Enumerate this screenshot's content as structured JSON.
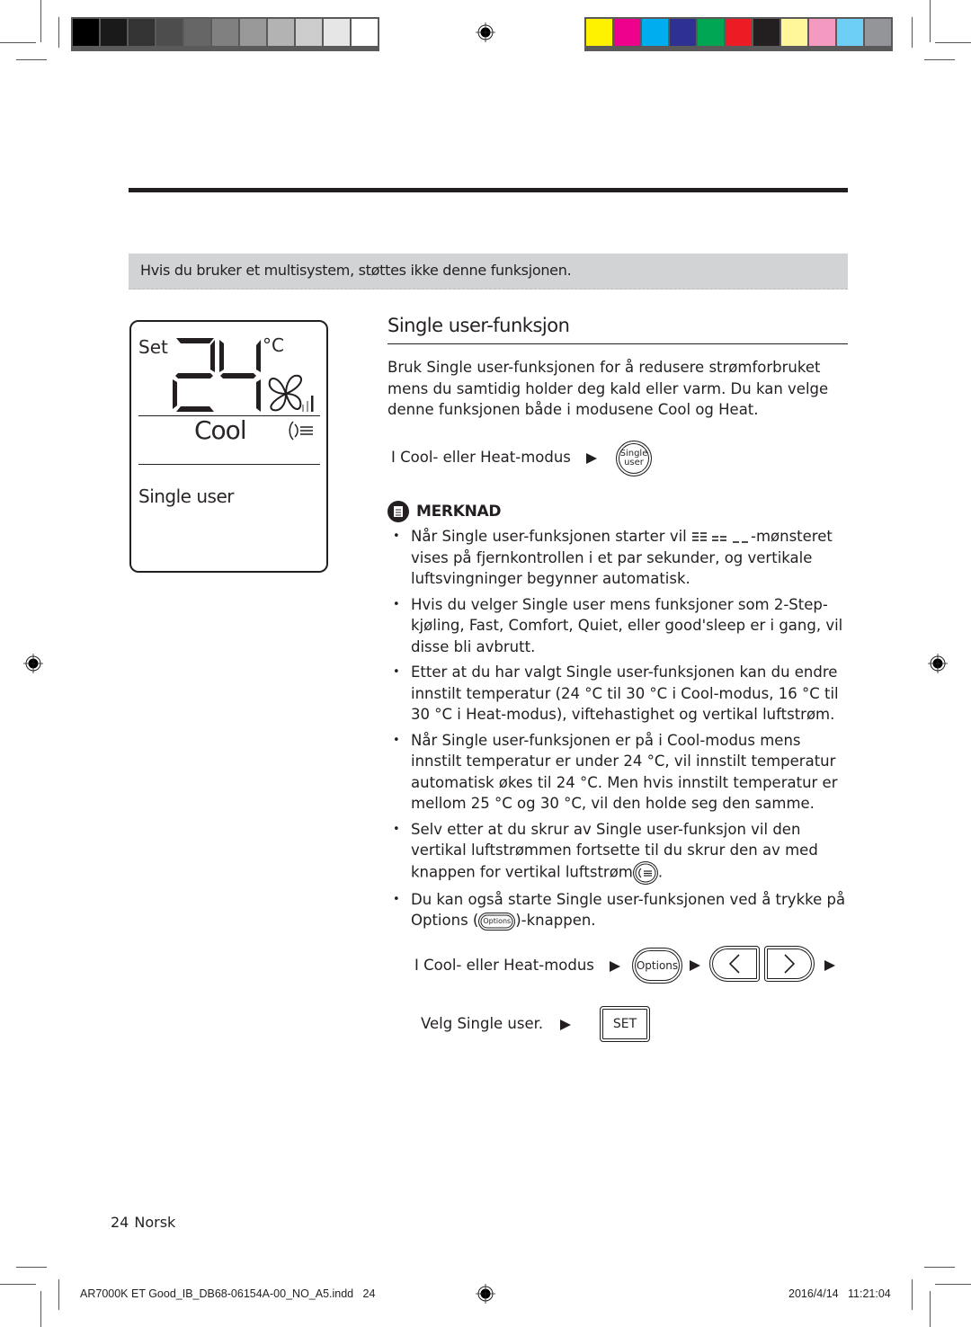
{
  "print_marks": {
    "gray_swatches": [
      "#000000",
      "#1a1a1a",
      "#333333",
      "#4d4d4d",
      "#666666",
      "#808080",
      "#999999",
      "#b3b3b3",
      "#cccccc",
      "#e6e6e6",
      "#ffffff"
    ],
    "color_swatches": [
      "#fff200",
      "#ec008c",
      "#00aeef",
      "#2e3192",
      "#00a651",
      "#ed1c24",
      "#231f20",
      "#fff799",
      "#f49ac1",
      "#6dcff6",
      "#939598"
    ]
  },
  "notice": "Hvis du bruker et multisystem, støttes ikke denne funksjonen.",
  "display": {
    "set_label": "Set",
    "temperature": "24",
    "unit": "°C",
    "mode": "Cool",
    "function": "Single user"
  },
  "section": {
    "title": "Single user-funksjon",
    "intro": "Bruk Single user-funksjonen for å redusere strømforbruket mens du samtidig holder deg kald eller varm. Du kan velge denne funksjonen både i modusene Cool og Heat.",
    "step1": {
      "text": "I Cool- eller  Heat-modus",
      "button": [
        "Single",
        "user"
      ]
    },
    "note_title": "MERKNAD",
    "notes": [
      {
        "before": "Når Single user-funksjonen starter vil ",
        "after": "-mønsteret vises på fjernkontrollen i et par sekunder, og vertikale luftsvingninger begynner automatisk."
      },
      {
        "text": "Hvis du velger Single user mens funksjoner som  2-Step-kjøling, Fast, Comfort, Quiet, eller good'sleep er i gang, vil disse bli avbrutt."
      },
      {
        "text": "Etter at du har valgt Single user-funksjonen kan du endre innstilt temperatur (24 °C til 30 °C i Cool-modus, 16 °C til 30 °C i Heat-modus), viftehastighet og vertikal luftstrøm."
      },
      {
        "text": "Når Single user-funksjonen er på i Cool-modus mens innstilt temperatur er under 24 °C, vil innstilt temperatur automatisk økes til 24 °C. Men hvis innstilt temperatur er mellom 25 °C og 30 °C, vil den holde seg den samme."
      },
      {
        "before": "Selv etter at du skrur av Single user-funksjon vil den vertikal luftstrømmen fortsette til du skrur den av med knappen for vertikal luftstrøm",
        "after": "."
      },
      {
        "before": "Du kan også starte Single user-funksjonen ved å trykke på Options (",
        "button": "Options",
        "after": ")-knappen."
      }
    ],
    "step2": {
      "text": "I Cool- eller  Heat-modus",
      "options_button": "Options",
      "left": "<",
      "right": ">"
    },
    "step3": {
      "text": "Velg Single user.",
      "set_button": "SET"
    }
  },
  "footer": {
    "page_number": "24",
    "language": "Norsk",
    "slug_file": "AR7000K ET Good_IB_DB68-06154A-00_NO_A5.indd   24",
    "slug_date": "2016/4/14   11:21:04"
  }
}
